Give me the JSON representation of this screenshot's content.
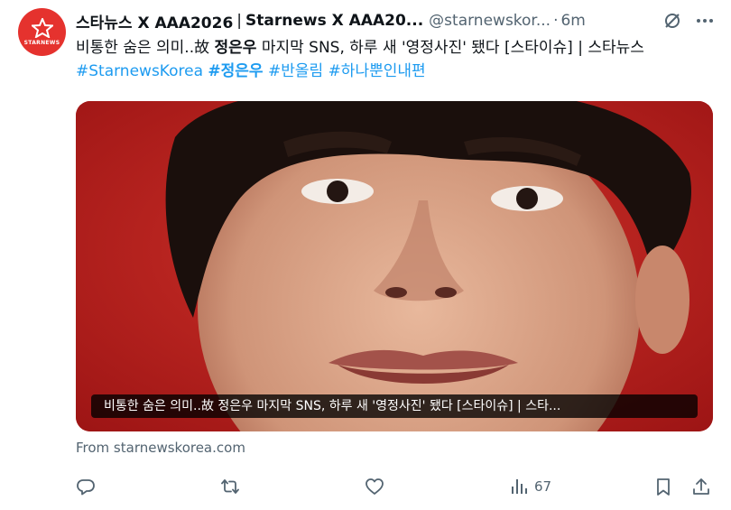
{
  "tweet": {
    "avatar_brand": "STARNEWS",
    "display_name": "스타뉴스 X AAA2026",
    "separator": "|",
    "display_name_2": "Starnews X AAA20...",
    "handle": "@starnewskor...",
    "dot": "·",
    "time": "6m",
    "text_part1": "비통한 숨은 의미..故 ",
    "text_bold": "정은우",
    "text_part2": " 마지막 SNS, 하루 새 '영정사진' 됐다 [스타이슈] | 스타뉴스 ",
    "hashtags": [
      "#StarnewsKorea",
      "#정은우",
      "#반올림",
      "#하나뿐인내편"
    ]
  },
  "card": {
    "caption": "비통한 숨은 의미..故 정은우 마지막 SNS, 하루 새 '영정사진' 됐다 [스타이슈] | 스타...",
    "source": "From starnewskorea.com"
  },
  "actions": {
    "reply_icon": "reply-icon",
    "retweet_icon": "retweet-icon",
    "like_icon": "like-icon",
    "views_icon": "views-icon",
    "views_count": "67",
    "bookmark_icon": "bookmark-icon",
    "share_icon": "share-icon"
  },
  "colors": {
    "brand_red": "#e5322e",
    "link_blue": "#1d9bf0",
    "secondary": "#536471",
    "text": "#0f1419"
  }
}
